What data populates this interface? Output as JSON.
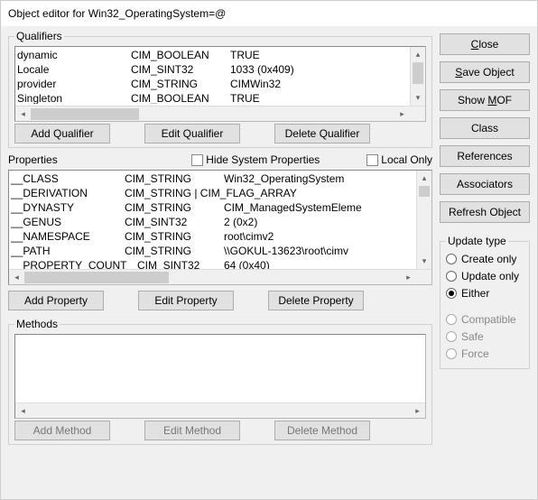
{
  "window": {
    "title": "Object editor for Win32_OperatingSystem=@"
  },
  "qualifiers": {
    "legend": "Qualifiers",
    "rows": [
      {
        "name": "dynamic",
        "type": "CIM_BOOLEAN",
        "value": "TRUE"
      },
      {
        "name": "Locale",
        "type": "CIM_SINT32",
        "value": "1033 (0x409)"
      },
      {
        "name": "provider",
        "type": "CIM_STRING",
        "value": "CIMWin32"
      },
      {
        "name": "Singleton",
        "type": "CIM_BOOLEAN",
        "value": "TRUE"
      }
    ],
    "buttons": {
      "add": "Add Qualifier",
      "edit": "Edit Qualifier",
      "delete": "Delete Qualifier"
    }
  },
  "properties": {
    "label": "Properties",
    "hide_system": "Hide System Properties",
    "local_only": "Local Only",
    "rows": [
      {
        "name": "__CLASS",
        "type": "CIM_STRING",
        "value": "Win32_OperatingSystem"
      },
      {
        "name": "__DERIVATION",
        "type": "CIM_STRING | CIM_FLAG_ARRAY",
        "value": ""
      },
      {
        "name": "__DYNASTY",
        "type": "CIM_STRING",
        "value": "CIM_ManagedSystemEleme"
      },
      {
        "name": "__GENUS",
        "type": "CIM_SINT32",
        "value": "2 (0x2)"
      },
      {
        "name": "__NAMESPACE",
        "type": "CIM_STRING",
        "value": "root\\cimv2"
      },
      {
        "name": "__PATH",
        "type": "CIM_STRING",
        "value": "\\\\GOKUL-13623\\root\\cimv"
      },
      {
        "name": "__PROPERTY_COUNT",
        "type": "CIM_SINT32",
        "value": "64 (0x40)"
      }
    ],
    "buttons": {
      "add": "Add Property",
      "edit": "Edit Property",
      "delete": "Delete Property"
    }
  },
  "methods": {
    "legend": "Methods",
    "buttons": {
      "add": "Add Method",
      "edit": "Edit Method",
      "delete": "Delete Method"
    }
  },
  "sidebar": {
    "close": "Close",
    "close_u": "C",
    "save": "Save Object",
    "save_u": "S",
    "show_mof": "Show MOF",
    "show_mof_u": "M",
    "class": "Class",
    "references": "References",
    "associators": "Associators",
    "refresh": "Refresh Object"
  },
  "update": {
    "legend": "Update type",
    "create_only": "Create only",
    "update_only": "Update only",
    "either": "Either",
    "compatible": "Compatible",
    "safe": "Safe",
    "force": "Force",
    "selected": "either"
  }
}
